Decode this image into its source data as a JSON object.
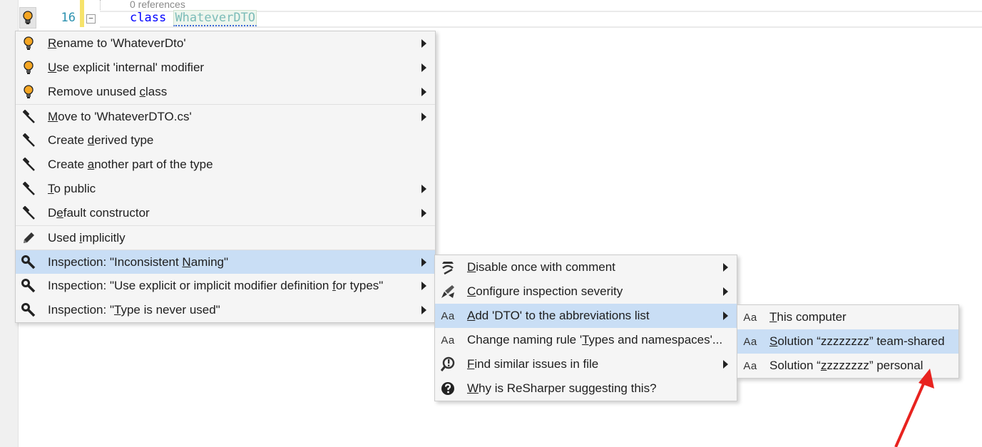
{
  "editor": {
    "hint": "0 references",
    "line_number": "16",
    "collapse": "−",
    "keyword": "class",
    "identifier": "WhateverDTO"
  },
  "menu_main": {
    "items": [
      {
        "pre": "",
        "u": "R",
        "post": "ename to 'WhateverDto'",
        "icon": "bulb-icon",
        "arrow": true
      },
      {
        "pre": "",
        "u": "U",
        "post": "se explicit 'internal' modifier",
        "icon": "bulb-icon",
        "arrow": true
      },
      {
        "pre": "Remove unused ",
        "u": "c",
        "post": "lass",
        "icon": "bulb-icon",
        "arrow": true
      },
      {
        "pre": "",
        "u": "M",
        "post": "ove to 'WhateverDTO.cs'",
        "icon": "hammer-icon",
        "arrow": true
      },
      {
        "pre": "Create ",
        "u": "d",
        "post": "erived type",
        "icon": "hammer-icon",
        "arrow": false
      },
      {
        "pre": "Create ",
        "u": "a",
        "post": "nother part of the type",
        "icon": "hammer-icon",
        "arrow": false
      },
      {
        "pre": "",
        "u": "T",
        "post": "o public",
        "icon": "hammer-icon",
        "arrow": true
      },
      {
        "pre": "D",
        "u": "e",
        "post": "fault constructor",
        "icon": "hammer-icon",
        "arrow": true
      },
      {
        "pre": "Used ",
        "u": "i",
        "post": "mplicitly",
        "icon": "pencil-icon",
        "arrow": false
      },
      {
        "pre": "Inspection: \"Inconsistent ",
        "u": "N",
        "post": "aming\"",
        "icon": "wrench-icon",
        "arrow": true
      },
      {
        "pre": "Inspection: \"Use explicit or implicit modifier definition ",
        "u": "f",
        "post": "or types\"",
        "icon": "wrench-icon",
        "arrow": true
      },
      {
        "pre": "Inspection: \"",
        "u": "T",
        "post": "ype is never used\"",
        "icon": "wrench-icon",
        "arrow": true
      }
    ]
  },
  "menu_inspection": {
    "items": [
      {
        "pre": "",
        "u": "D",
        "post": "isable once with comment",
        "icon": "disable-comment-icon",
        "arrow": true
      },
      {
        "pre": "",
        "u": "C",
        "post": "onfigure inspection severity",
        "icon": "severity-brush-icon",
        "arrow": true
      },
      {
        "pre": "",
        "u": "A",
        "post": "dd 'DTO' to the abbreviations list",
        "icon": "aa-icon",
        "arrow": true
      },
      {
        "pre": "Change naming rule '",
        "u": "T",
        "post": "ypes and namespaces'...",
        "icon": "aa-icon",
        "arrow": false
      },
      {
        "pre": "",
        "u": "F",
        "post": "ind similar issues in file",
        "icon": "find-issues-icon",
        "arrow": true
      },
      {
        "pre": "",
        "u": "W",
        "post": "hy is ReSharper suggesting this?",
        "icon": "help-icon",
        "arrow": false
      }
    ]
  },
  "menu_abbrev": {
    "items": [
      {
        "pre": "",
        "u": "T",
        "post": "his computer",
        "icon": "aa-icon"
      },
      {
        "pre": "",
        "u": "S",
        "post": "olution “zzzzzzzz” team-shared",
        "icon": "aa-icon"
      },
      {
        "pre": "Solution “",
        "u": "z",
        "post": "zzzzzzz” personal",
        "icon": "aa-icon"
      }
    ]
  },
  "icon_text": {
    "aa": "Aa"
  },
  "colors": {
    "selection": "#c9def5",
    "menu_bg": "#f5f5f5",
    "keyword": "#0000ff",
    "line_number": "#2b91af",
    "bulb": "#f5a623",
    "annotation_arrow": "#e8231f"
  }
}
